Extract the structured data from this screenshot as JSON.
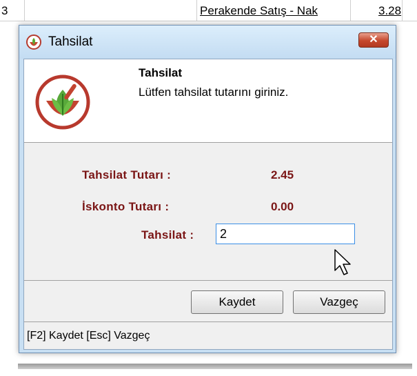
{
  "background_row": {
    "col1": "3",
    "col3": "Perakende Satış - Nak",
    "col4": "3.28"
  },
  "dialog": {
    "title": "Tahsilat",
    "close_label": "✕",
    "header": {
      "title": "Tahsilat",
      "subtitle": "Lütfen tahsilat tutarını giriniz."
    },
    "form": {
      "amount_label": "Tahsilat Tutarı :",
      "amount_value": "2.45",
      "discount_label": "İskonto Tutarı :",
      "discount_value": "0.00",
      "payment_label": "Tahsilat :",
      "payment_input_value": "2"
    },
    "buttons": {
      "save": "Kaydet",
      "cancel": "Vazgeç"
    },
    "status": "[F2] Kaydet  [Esc] Vazgeç"
  },
  "colors": {
    "label_color": "#7a1515",
    "title_bar": "#c8dff3",
    "close_button": "#c5482d",
    "input_border": "#3a8ee6"
  },
  "icons": {
    "app_icon": "herbal-leaf-mortar-icon",
    "close_icon": "close-icon",
    "cursor": "mouse-pointer-icon"
  }
}
